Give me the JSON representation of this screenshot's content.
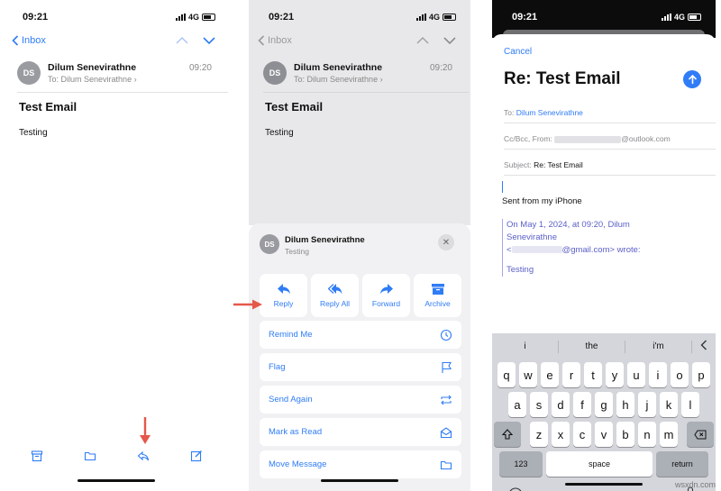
{
  "status": {
    "time": "09:21",
    "network": "4G"
  },
  "panel1": {
    "back_label": "Inbox",
    "sender_initials": "DS",
    "sender_name": "Dilum Senevirathne",
    "to_label": "To:",
    "to_name": "Dilum Senevirathne",
    "sent_time": "09:20",
    "subject": "Test Email",
    "body": "Testing"
  },
  "panel2": {
    "back_label": "Inbox",
    "sender_initials": "DS",
    "sender_name": "Dilum Senevirathne",
    "to_label": "To:",
    "to_name": "Dilum Senevirathne",
    "sent_time": "09:20",
    "subject": "Test Email",
    "body": "Testing",
    "sheet_sender": "Dilum Senevirathne",
    "sheet_preview": "Testing",
    "actions": [
      "Reply",
      "Reply All",
      "Forward",
      "Archive"
    ],
    "menu": [
      "Remind Me",
      "Flag",
      "Send Again",
      "Mark as Read",
      "Move Message"
    ]
  },
  "panel3": {
    "cancel": "Cancel",
    "title": "Re: Test Email",
    "to_label": "To:",
    "to_value": "Dilum Senevirathne",
    "ccbcc_label": "Cc/Bcc, From:",
    "from_domain": "@outlook.com",
    "subject_label": "Subject:",
    "subject_value": "Re: Test Email",
    "signature": "Sent from my iPhone",
    "quote_line1": "On May 1, 2024, at 09:20, Dilum Senevirathne",
    "quote_line2_prefix": "<",
    "quote_line2_suffix": "@gmail.com> wrote:",
    "quote_body": "Testing",
    "suggestions": [
      "i",
      "the",
      "i'm"
    ],
    "keys_row1": [
      "q",
      "w",
      "e",
      "r",
      "t",
      "y",
      "u",
      "i",
      "o",
      "p"
    ],
    "keys_row2": [
      "a",
      "s",
      "d",
      "f",
      "g",
      "h",
      "j",
      "k",
      "l"
    ],
    "keys_row3": [
      "z",
      "x",
      "c",
      "v",
      "b",
      "n",
      "m"
    ],
    "key_123": "123",
    "key_space": "space",
    "key_return": "return"
  },
  "watermark": "wsxdn.com",
  "colors": {
    "accent": "#2f7cf6",
    "arrow": "#e5584a",
    "quote": "#5b5fc7"
  }
}
